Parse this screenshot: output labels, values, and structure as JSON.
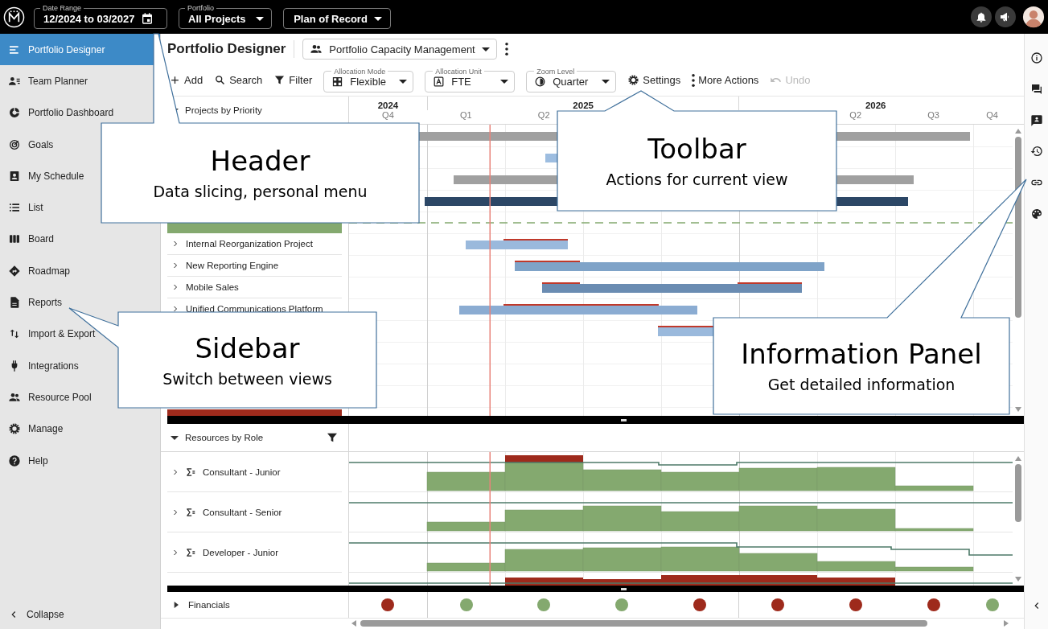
{
  "header": {
    "date_range": {
      "label": "Date Range",
      "value": "12/2024 to 03/2027"
    },
    "portfolio": {
      "label": "Portfolio",
      "value": "All Projects"
    },
    "scenario": {
      "value": "Plan of Record"
    }
  },
  "sidebar": {
    "items": [
      {
        "label": "Portfolio Designer",
        "selected": true
      },
      {
        "label": "Team Planner",
        "selected": false
      },
      {
        "label": "Portfolio Dashboard",
        "selected": false
      },
      {
        "label": "Goals",
        "selected": false
      },
      {
        "label": "My Schedule",
        "selected": false
      },
      {
        "label": "List",
        "selected": false
      },
      {
        "label": "Board",
        "selected": false
      },
      {
        "label": "Roadmap",
        "selected": false
      },
      {
        "label": "Reports",
        "selected": false
      },
      {
        "label": "Import & Export",
        "selected": false
      },
      {
        "label": "Integrations",
        "selected": false
      },
      {
        "label": "Resource Pool",
        "selected": false
      },
      {
        "label": "Manage",
        "selected": false
      },
      {
        "label": "Help",
        "selected": false
      }
    ],
    "collapse": "Collapse"
  },
  "page": {
    "title": "Portfolio Designer",
    "view": "Portfolio Capacity Management"
  },
  "toolbar": {
    "items": [
      {
        "kind": "button",
        "label": "Add",
        "disabled": false
      },
      {
        "kind": "button",
        "label": "Search",
        "disabled": false
      },
      {
        "kind": "button",
        "label": "Filter",
        "disabled": false
      },
      {
        "kind": "select",
        "label": "Allocation Mode",
        "value": "Flexible"
      },
      {
        "kind": "select",
        "label": "Allocation Unit",
        "value": "FTE"
      },
      {
        "kind": "select",
        "label": "Zoom Level",
        "value": "Quarter"
      },
      {
        "kind": "button",
        "label": "Settings",
        "disabled": false
      },
      {
        "kind": "button",
        "label": "More Actions",
        "disabled": false
      },
      {
        "kind": "button",
        "label": "Undo",
        "disabled": true
      }
    ]
  },
  "timeline": {
    "years": [
      "2024",
      "2025",
      "2026"
    ],
    "quarters": [
      "Q4",
      "Q1",
      "Q2",
      "Q2",
      "Q3",
      "Q4"
    ]
  },
  "projects": {
    "heading": "Projects by Priority",
    "expanded": true,
    "rows": [
      {
        "name": "Internal Reorganization Project",
        "expanded": false
      },
      {
        "name": "New Reporting Engine",
        "expanded": false
      },
      {
        "name": "Mobile Sales",
        "expanded": false
      },
      {
        "name": "Unified Communications Platform",
        "expanded": false
      }
    ]
  },
  "resources": {
    "heading": "Resources by Role",
    "expanded": true,
    "rows": [
      {
        "name": "Consultant - Junior",
        "expanded": false
      },
      {
        "name": "Consultant - Senior",
        "expanded": false
      },
      {
        "name": "Developer - Junior",
        "expanded": false
      }
    ]
  },
  "financials": {
    "label": "Financials",
    "expanded": false,
    "statuses": [
      {
        "color": "#9e2a1c"
      },
      {
        "color": "#84a96f"
      },
      {
        "color": "#84a96f"
      },
      {
        "color": "#84a96f"
      },
      {
        "color": "#9e2a1c"
      },
      {
        "color": "#9e2a1c"
      },
      {
        "color": "#9e2a1c"
      },
      {
        "color": "#9e2a1c"
      },
      {
        "color": "#84a96f"
      }
    ]
  },
  "callouts": [
    {
      "title": "Header",
      "text": "Data slicing, personal menu"
    },
    {
      "title": "Toolbar",
      "text": "Actions for current view"
    },
    {
      "title": "Sidebar",
      "text": "Switch between views"
    },
    {
      "title": "Information Panel",
      "text": "Get detailed information"
    }
  ]
}
